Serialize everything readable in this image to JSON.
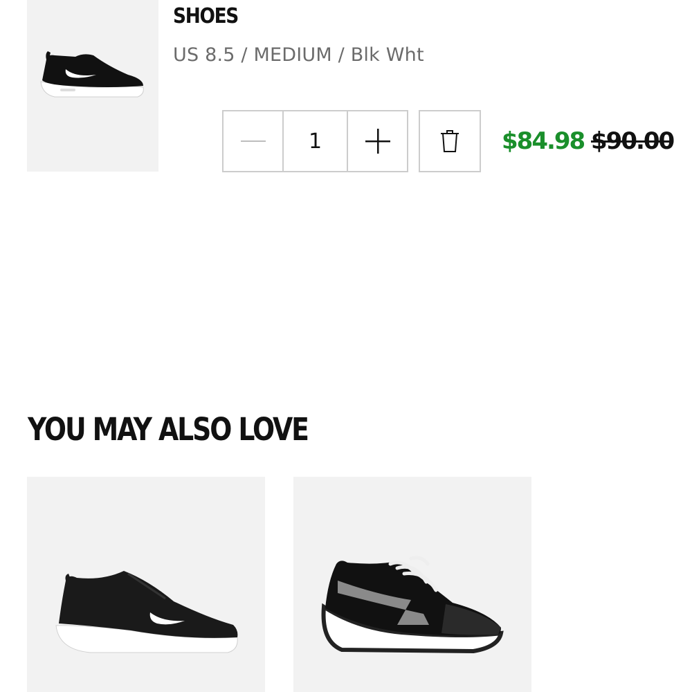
{
  "cart_item": {
    "title": "SHOES",
    "variant": "US 8.5 / MEDIUM / Blk Wht",
    "quantity": "1",
    "sale_price": "$84.98",
    "original_price": "$90.00",
    "sale_color": "#1a8f2b",
    "icons": {
      "decrease": "minus-icon",
      "increase": "plus-icon",
      "remove": "trash-icon"
    }
  },
  "recommendations": {
    "heading": "YOU MAY ALSO LOVE",
    "items": [
      {
        "image": "black-white-running-shoe"
      },
      {
        "image": "black-suede-lace-up-sneaker"
      }
    ]
  }
}
